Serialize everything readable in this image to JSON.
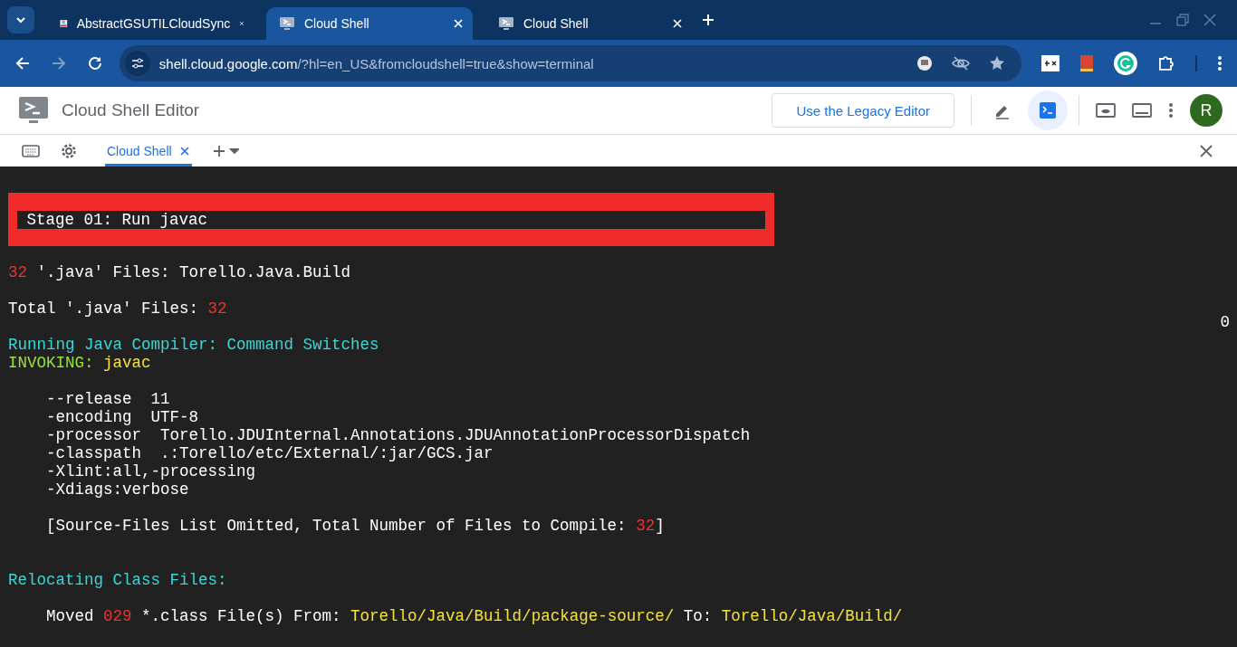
{
  "browser": {
    "tabs": [
      {
        "title": "AbstractGSUTILCloudSync",
        "selected": false,
        "kind": "document"
      },
      {
        "title": "Cloud Shell",
        "selected": true,
        "kind": "shell"
      },
      {
        "title": "Cloud Shell",
        "selected": false,
        "kind": "shell"
      }
    ],
    "url": {
      "host": "shell.cloud.google.com",
      "path": "/?hl=en_US&fromcloudshell=true&show=terminal"
    }
  },
  "app": {
    "title": "Cloud Shell Editor",
    "legacy_button": "Use the Legacy Editor",
    "avatar": "R",
    "view_buttons": [
      {
        "kind": "editor",
        "selected": false
      },
      {
        "kind": "terminal",
        "selected": true
      }
    ]
  },
  "terminal_tabs": [
    {
      "label": "Cloud Shell",
      "selected": true
    }
  ],
  "terminal": {
    "banner": " Stage 01: Run javac",
    "side_marker": "0",
    "lines": [
      {
        "kind": "text",
        "segments": [
          {
            "text": "32",
            "color": "#f03232"
          },
          {
            "text": " '.java' Files: Torello.Java.Build",
            "color": "#ffffff"
          }
        ]
      },
      {
        "kind": "blank"
      },
      {
        "kind": "text",
        "segments": [
          {
            "text": "Total '.java' Files: ",
            "color": "#ffffff"
          },
          {
            "text": "32",
            "color": "#f03232"
          }
        ]
      },
      {
        "kind": "blank"
      },
      {
        "kind": "text",
        "segments": [
          {
            "text": "Running Java Compiler: Command Switches",
            "color": "#3ad7d7"
          }
        ]
      },
      {
        "kind": "text",
        "segments": [
          {
            "text": "INVOKING: ",
            "color": "#9be03a"
          },
          {
            "text": "javac",
            "color": "#f5e23a"
          }
        ]
      },
      {
        "kind": "blank"
      },
      {
        "kind": "text",
        "segments": [
          {
            "text": "    --release  11",
            "color": "#ffffff"
          }
        ]
      },
      {
        "kind": "text",
        "segments": [
          {
            "text": "    -encoding  UTF-8",
            "color": "#ffffff"
          }
        ]
      },
      {
        "kind": "text",
        "segments": [
          {
            "text": "    -processor  Torello.JDUInternal.Annotations.JDUAnnotationProcessorDispatch",
            "color": "#ffffff"
          }
        ]
      },
      {
        "kind": "text",
        "segments": [
          {
            "text": "    -classpath  .:Torello/etc/External/:jar/GCS.jar",
            "color": "#ffffff"
          }
        ]
      },
      {
        "kind": "text",
        "segments": [
          {
            "text": "    -Xlint:all,-processing",
            "color": "#ffffff"
          }
        ]
      },
      {
        "kind": "text",
        "segments": [
          {
            "text": "    -Xdiags:verbose",
            "color": "#ffffff"
          }
        ]
      },
      {
        "kind": "blank"
      },
      {
        "kind": "text",
        "segments": [
          {
            "text": "    [Source-Files List Omitted, Total Number of Files to Compile: ",
            "color": "#ffffff"
          },
          {
            "text": "32",
            "color": "#f03232"
          },
          {
            "text": "]",
            "color": "#ffffff"
          }
        ]
      },
      {
        "kind": "blank"
      },
      {
        "kind": "blank"
      },
      {
        "kind": "text",
        "segments": [
          {
            "text": "Relocating Class Files:",
            "color": "#3ad7d7"
          }
        ]
      },
      {
        "kind": "blank"
      },
      {
        "kind": "text",
        "segments": [
          {
            "text": "    Moved ",
            "color": "#ffffff"
          },
          {
            "text": "029",
            "color": "#f03232"
          },
          {
            "text": " *.class File(s) From: ",
            "color": "#ffffff"
          },
          {
            "text": "Torello/Java/Build/package-source/",
            "color": "#f5e23a"
          },
          {
            "text": " To: ",
            "color": "#ffffff"
          },
          {
            "text": "Torello/Java/Build/",
            "color": "#f5e23a"
          }
        ]
      }
    ]
  }
}
